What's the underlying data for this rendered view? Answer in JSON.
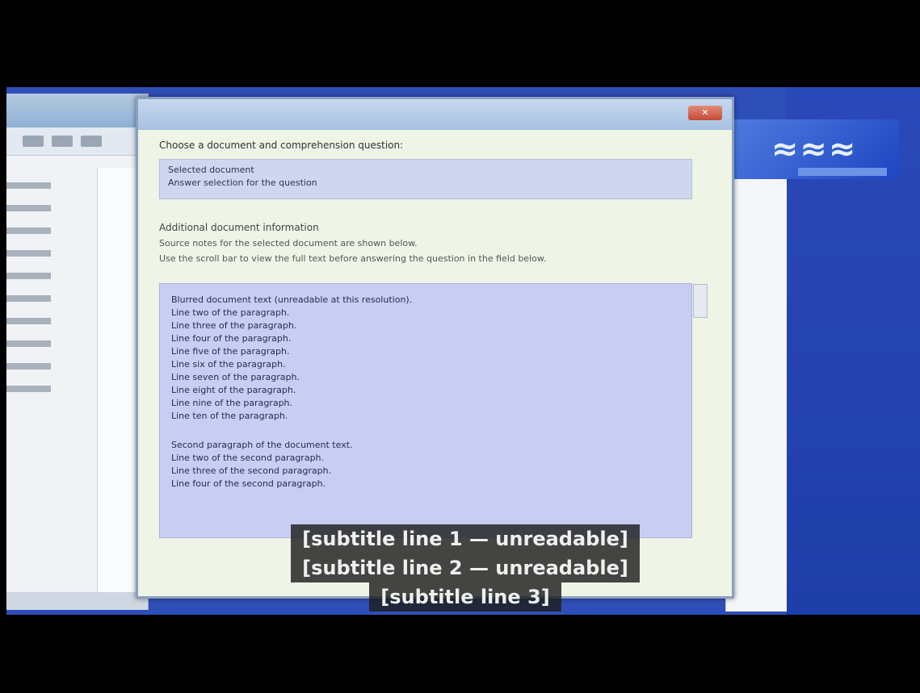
{
  "dialog": {
    "close_label": "✕",
    "question": "Choose a document and comprehension question:",
    "selection_lines": [
      "Selected document",
      "Answer selection for the question"
    ],
    "section_title": "Additional document information",
    "section_lines": [
      "Source notes for the selected document are shown below.",
      "Use the scroll bar to view the full text before answering the question in the field below."
    ],
    "paragraphs": [
      "Blurred document text (unreadable at this resolution).\nLine two of the paragraph.\nLine three of the paragraph.\nLine four of the paragraph.\nLine five of the paragraph.\nLine six of the paragraph.\nLine seven of the paragraph.\nLine eight of the paragraph.\nLine nine of the paragraph.\nLine ten of the paragraph.",
      "Second paragraph of the document text.\nLine two of the second paragraph.\nLine three of the second paragraph.\nLine four of the second paragraph."
    ]
  },
  "subtitles": [
    "[subtitle line 1 — unreadable]",
    "[subtitle line 2 — unreadable]",
    "[subtitle line 3]"
  ],
  "brand": {
    "logo_text": "≈≈≈"
  },
  "colors": {
    "desktop": "#2f4fb8",
    "dialog_bg": "#eef4e6",
    "text_selection": "#c9cdf3",
    "subtitle_bg": "#1e1e1e"
  }
}
